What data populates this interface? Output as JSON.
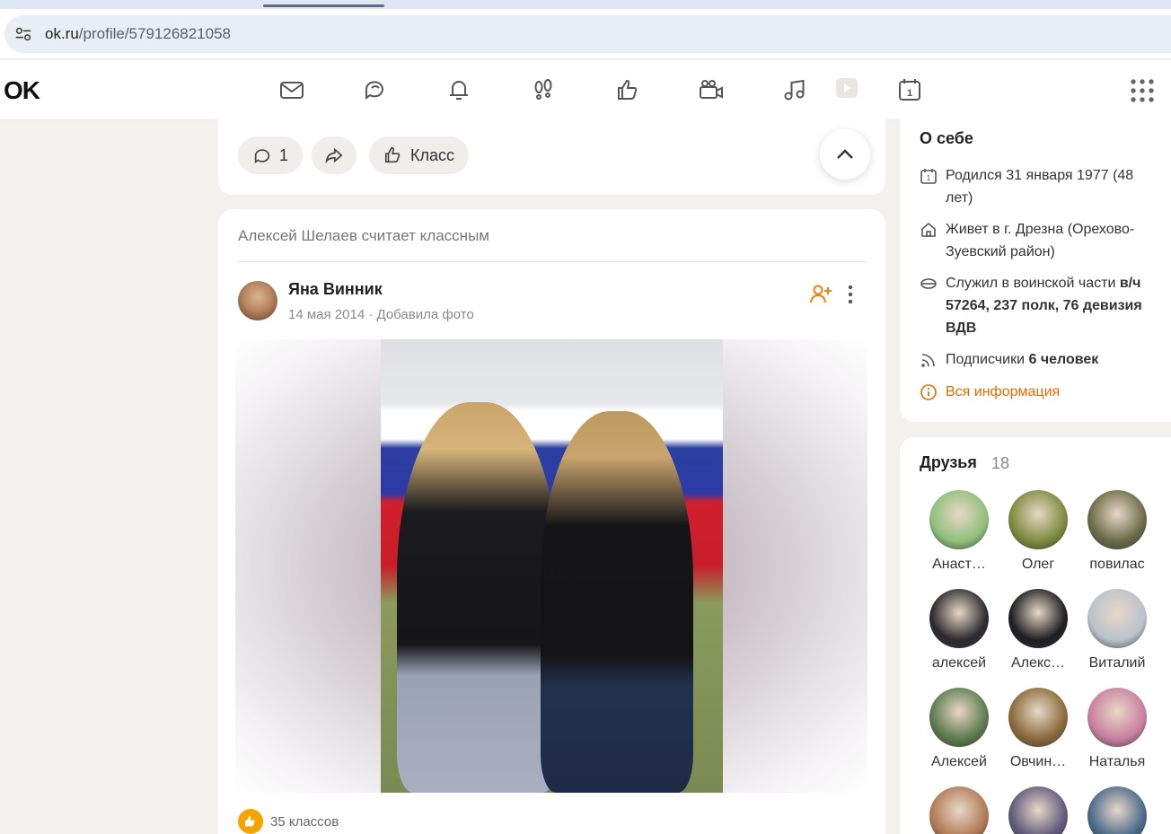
{
  "browser": {
    "url_host": "ok.ru",
    "url_path": "/profile/579126821058"
  },
  "header": {
    "logo": "OK",
    "nav_icons": [
      "mail-icon",
      "chat-icon",
      "bell-icon",
      "guests-icon",
      "like-icon",
      "video-camera-icon",
      "music-icon",
      "play-icon",
      "calendar-icon"
    ]
  },
  "post_actions": {
    "comments_count": "1",
    "class_label": "Класс"
  },
  "post": {
    "liked_by": "Алексей Шелаев считает классным",
    "author": "Яна Винник",
    "date": "14 мая 2014",
    "separator": "·",
    "action": "Добавила фото",
    "likes_label": "35 классов"
  },
  "about": {
    "title": "О себе",
    "born": "Родился 31 января 1977 (48 лет)",
    "lives": "Живет в г. Дрезна (Орехово-Зуевский район)",
    "served_prefix": "Служил в воинской части ",
    "served_bold": "в/ч 57264, 237 полк, 76 девизия ВДВ",
    "subscribers_prefix": "Подписчики ",
    "subscribers_bold": "6 человек",
    "all_info": "Вся информация"
  },
  "friends": {
    "title": "Друзья",
    "count": "18",
    "items": [
      {
        "name": "Анаст…",
        "color": "#8fbf7a"
      },
      {
        "name": "Олег",
        "color": "#7d8a3c"
      },
      {
        "name": "повилас",
        "color": "#6b6a48"
      },
      {
        "name": "алексей",
        "color": "#2c2a2e"
      },
      {
        "name": "Алекс…",
        "color": "#1e1e22"
      },
      {
        "name": "Виталий",
        "color": "#b9c2cc"
      },
      {
        "name": "Алексей",
        "color": "#5d7a4e"
      },
      {
        "name": "Овчин…",
        "color": "#8a6a3a"
      },
      {
        "name": "Наталья",
        "color": "#c87fa0"
      },
      {
        "name": "",
        "color": "#b07a55"
      },
      {
        "name": "",
        "color": "#5f5a7a"
      },
      {
        "name": "",
        "color": "#4a6a8a"
      }
    ]
  },
  "colors": {
    "accent": "#ee8208",
    "page_bg": "#f3f1ee"
  }
}
